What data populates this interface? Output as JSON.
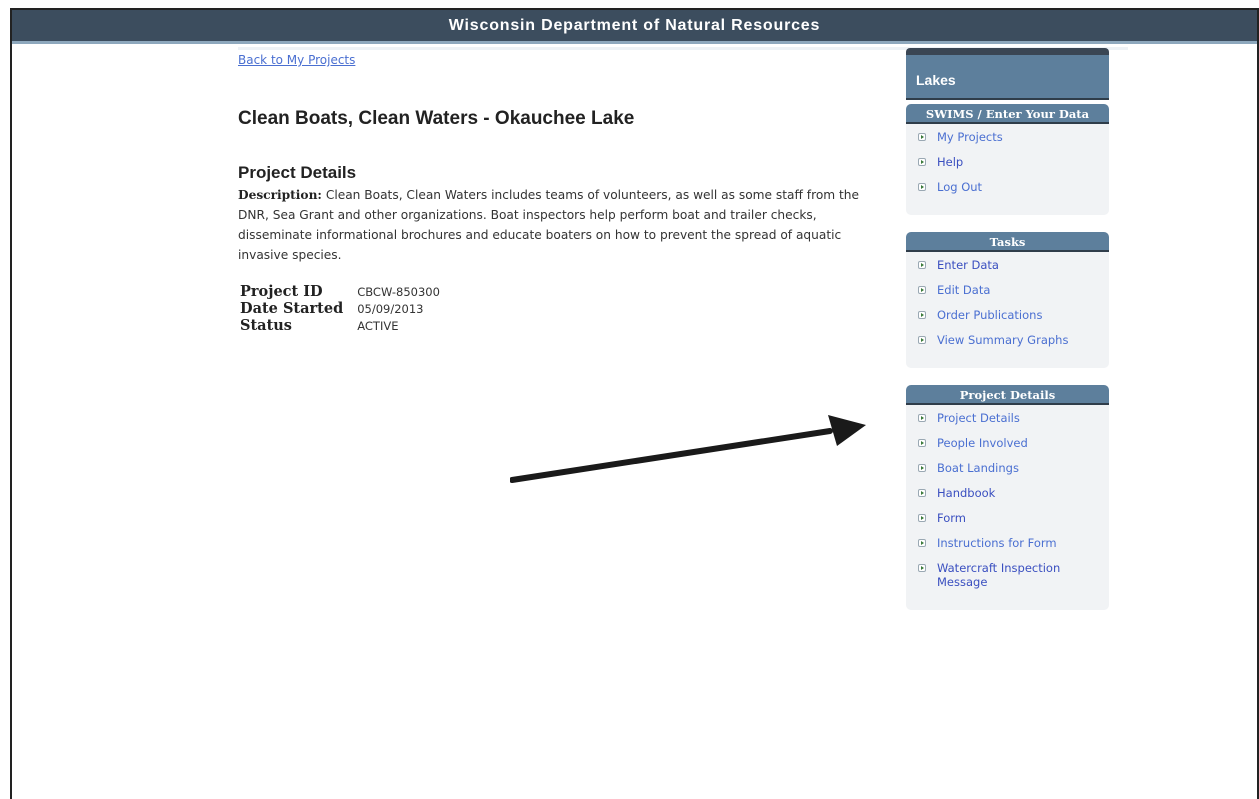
{
  "header": {
    "title": "Wisconsin Department of Natural Resources"
  },
  "main": {
    "back_link": "Back to My Projects",
    "title": "Clean Boats, Clean Waters - Okauchee Lake",
    "section_title": "Project Details",
    "description_label": "Description:",
    "description_text": "Clean Boats, Clean Waters includes teams of volunteers, as well as some staff from the DNR, Sea Grant and other organizations. Boat inspectors help perform boat and trailer checks, disseminate informational brochures and educate boaters on how to prevent the spread of aquatic invasive species.",
    "details": [
      {
        "label": "Project ID",
        "value": "CBCW-850300"
      },
      {
        "label": "Date Started",
        "value": "05/09/2013"
      },
      {
        "label": "Status",
        "value": "ACTIVE"
      }
    ]
  },
  "sidebar": {
    "heading": "Lakes",
    "panels": [
      {
        "title": "SWIMS / Enter Your Data",
        "items": [
          {
            "label": "My Projects"
          },
          {
            "label": "Help"
          },
          {
            "label": "Log Out"
          }
        ]
      },
      {
        "title": "Tasks",
        "items": [
          {
            "label": "Enter Data"
          },
          {
            "label": "Edit Data"
          },
          {
            "label": "Order Publications"
          },
          {
            "label": "View Summary Graphs"
          }
        ]
      },
      {
        "title": "Project Details",
        "items": [
          {
            "label": "Project Details"
          },
          {
            "label": "People Involved"
          },
          {
            "label": "Boat Landings"
          },
          {
            "label": "Handbook"
          },
          {
            "label": "Form"
          },
          {
            "label": "Instructions for Form"
          },
          {
            "label": "Watercraft Inspection Message"
          }
        ]
      }
    ]
  },
  "colors": {
    "header_bg": "#3c4d5e",
    "panel_head": "#5d7f9c",
    "link": "#4a6fd1",
    "arrow": "#1a1a1a"
  },
  "icons": {
    "bullet": "arrow-bullet-icon",
    "annotation": "annotation-arrow-icon"
  }
}
